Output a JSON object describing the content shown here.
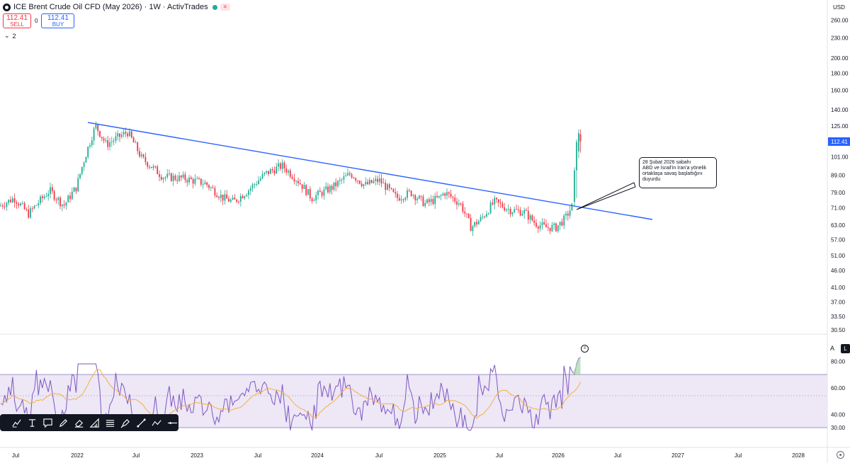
{
  "header": {
    "title": "ICE Brent Crude Oil CFD (May 2026) · 1W · ActivTrades"
  },
  "trade": {
    "sell_price": "112.41",
    "sell_label": "SELL",
    "spread": "0",
    "buy_price": "112.41",
    "buy_label": "BUY"
  },
  "collapse": {
    "count": "2"
  },
  "price_scale": {
    "currency": "USD",
    "current_price": "112.41",
    "labels": [
      "260.00",
      "230.00",
      "200.00",
      "180.00",
      "160.00",
      "140.00",
      "125.00",
      "101.00",
      "89.00",
      "79.00",
      "71.00",
      "63.00",
      "57.00",
      "51.00",
      "46.00",
      "41.00",
      "37.00",
      "33.50",
      "30.50"
    ]
  },
  "rsi_scale": {
    "labels": [
      "80.00",
      "60.00",
      "40.00",
      "30.00"
    ]
  },
  "time_axis": [
    "Jul",
    "2022",
    "Jul",
    "2023",
    "Jul",
    "2024",
    "Jul",
    "2025",
    "Jul",
    "2026",
    "Jul",
    "2027",
    "Jul",
    "2028"
  ],
  "annotation": {
    "lines": [
      "28 Şubat 2026 sabahı",
      "ABD ve İsrail'in İran'a yönelik",
      " ortaklaşa savaş başlattığını",
      "duyurdu"
    ]
  },
  "scale_buttons": {
    "auto": "A",
    "log": "L"
  },
  "colors": {
    "up": "#22ab94",
    "down": "#f23645",
    "trend": "#2962ff",
    "rsi": "#7e57c2",
    "rsi_ma": "#f5b041",
    "rsi_band": "#ede7f6"
  },
  "toolbar_icons": [
    "brush-icon",
    "text-icon",
    "note-icon",
    "pencil-icon",
    "eraser-icon",
    "ruler-icon",
    "lines-icon",
    "pen-icon",
    "trendline-icon",
    "path-icon",
    "hline-icon"
  ],
  "chart_data": {
    "type": "candlestick",
    "timeframe": "1W",
    "y_scale": "log",
    "current_price": 112.41,
    "candles_approx": [
      {
        "date": "2021-06",
        "o": 70,
        "h": 75,
        "l": 68,
        "c": 73
      },
      {
        "date": "2021-10",
        "o": 76,
        "h": 86,
        "l": 74,
        "c": 84
      },
      {
        "date": "2021-12",
        "o": 74,
        "h": 80,
        "l": 66,
        "c": 78
      },
      {
        "date": "2022-03",
        "o": 97,
        "h": 139,
        "l": 95,
        "c": 112
      },
      {
        "date": "2022-06",
        "o": 115,
        "h": 125,
        "l": 108,
        "c": 120
      },
      {
        "date": "2022-09",
        "o": 95,
        "h": 100,
        "l": 84,
        "c": 88
      },
      {
        "date": "2023-03",
        "o": 84,
        "h": 87,
        "l": 70,
        "c": 76
      },
      {
        "date": "2023-09",
        "o": 90,
        "h": 97,
        "l": 88,
        "c": 96
      },
      {
        "date": "2023-12",
        "o": 76,
        "h": 79,
        "l": 72,
        "c": 77
      },
      {
        "date": "2024-04",
        "o": 87,
        "h": 92,
        "l": 85,
        "c": 89
      },
      {
        "date": "2024-09",
        "o": 75,
        "h": 78,
        "l": 69,
        "c": 72
      },
      {
        "date": "2025-01",
        "o": 76,
        "h": 82,
        "l": 73,
        "c": 79
      },
      {
        "date": "2025-04",
        "o": 72,
        "h": 74,
        "l": 58,
        "c": 62
      },
      {
        "date": "2025-06",
        "o": 67,
        "h": 81,
        "l": 65,
        "c": 74
      },
      {
        "date": "2025-10",
        "o": 66,
        "h": 68,
        "l": 60,
        "c": 63
      },
      {
        "date": "2026-01",
        "o": 61,
        "h": 67,
        "l": 60,
        "c": 66
      },
      {
        "date": "2026-02",
        "o": 70,
        "h": 74,
        "l": 68,
        "c": 73
      },
      {
        "date": "2026-03",
        "o": 73,
        "h": 119,
        "l": 72,
        "c": 112.41
      }
    ],
    "trendline": {
      "start": {
        "date": "2022-03",
        "price": 130
      },
      "end": {
        "date": "2026-08",
        "price": 66
      }
    },
    "rsi": {
      "overbought": 70,
      "oversold": 30,
      "latest": 82
    }
  }
}
